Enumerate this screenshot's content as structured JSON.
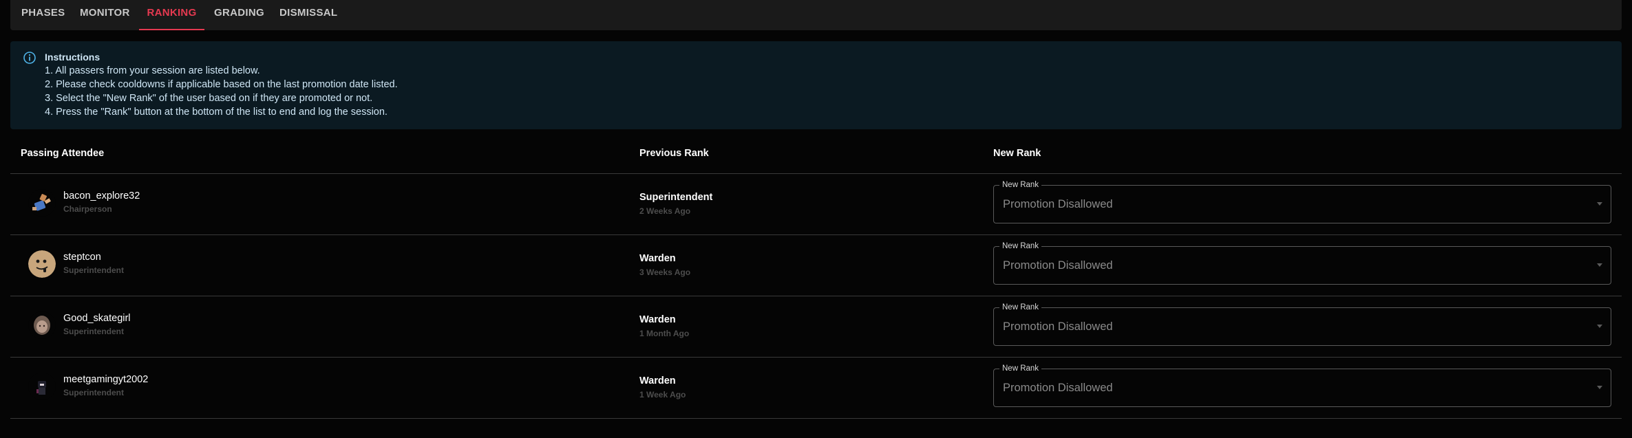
{
  "tabs": [
    {
      "label": "PHASES",
      "active": false
    },
    {
      "label": "MONITOR",
      "active": false
    },
    {
      "label": "RANKING",
      "active": true
    },
    {
      "label": "GRADING",
      "active": false
    },
    {
      "label": "DISMISSAL",
      "active": false
    }
  ],
  "instructions": {
    "icon": "info-icon",
    "title": "Instructions",
    "lines": [
      "1. All passers from your session are listed below.",
      "2. Please check cooldowns if applicable based on the last promotion date listed.",
      "3. Select the \"New Rank\" of the user based on if they are promoted or not.",
      "4. Press the \"Rank\" button at the bottom of the list to end and log the session."
    ]
  },
  "table": {
    "headers": {
      "attendee": "Passing Attendee",
      "previous_rank": "Previous Rank",
      "new_rank": "New Rank"
    },
    "rows": [
      {
        "username": "bacon_explore32",
        "user_rank": "Chairperson",
        "previous_rank": "Superintendent",
        "previous_date": "2 Weeks Ago",
        "select_label": "New Rank",
        "select_value": "Promotion Disallowed"
      },
      {
        "username": "steptcon",
        "user_rank": "Superintendent",
        "previous_rank": "Warden",
        "previous_date": "3 Weeks Ago",
        "select_label": "New Rank",
        "select_value": "Promotion Disallowed"
      },
      {
        "username": "Good_skategirl",
        "user_rank": "Superintendent",
        "previous_rank": "Warden",
        "previous_date": "1 Month Ago",
        "select_label": "New Rank",
        "select_value": "Promotion Disallowed"
      },
      {
        "username": "meetgamingyt2002",
        "user_rank": "Superintendent",
        "previous_rank": "Warden",
        "previous_date": "1 Week Ago",
        "select_label": "New Rank",
        "select_value": "Promotion Disallowed"
      }
    ]
  },
  "colors": {
    "accent": "#e53950",
    "info_bg": "#0b1a22",
    "info_text": "#cfe6f5",
    "muted_text": "#4d4d4d"
  }
}
